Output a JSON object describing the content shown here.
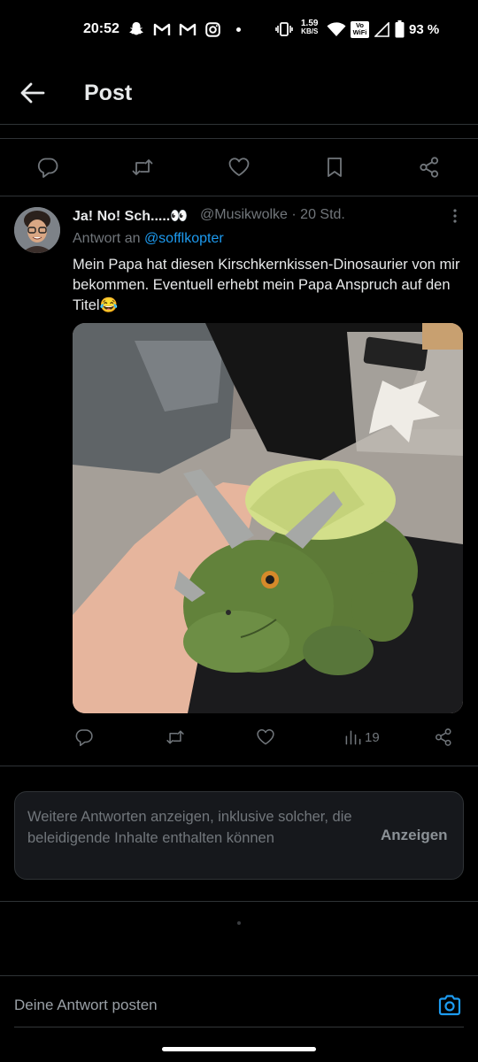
{
  "status_bar": {
    "time": "20:52",
    "net_speed_value": "1.59",
    "net_speed_unit": "KB/S",
    "wifi_label": "Vo WiFi",
    "battery": "93 %"
  },
  "header": {
    "title": "Post"
  },
  "reply": {
    "display_name": "Ja! No! Sch.....👀",
    "handle": "@Musikwolke",
    "time": "· 20 Std.",
    "reply_to_prefix": "Antwort an",
    "reply_to_handle": "@sofflkopter",
    "text": "Mein Papa hat diesen Kirschkernkissen-Dinosaurier von mir bekommen. Eventuell erhebt mein Papa Anspruch auf den Titel😂",
    "views": "19"
  },
  "more_replies": {
    "text": "Weitere Antworten anzeigen, inklusive solcher, die beleidigende Inhalte enthalten können",
    "button": "Anzeigen"
  },
  "composer": {
    "placeholder": "Deine Antwort posten"
  },
  "colors": {
    "background": "#000000",
    "text_primary": "#e7e9ea",
    "text_secondary": "#71767b",
    "accent": "#1d9bf0",
    "border": "#2f3336"
  }
}
